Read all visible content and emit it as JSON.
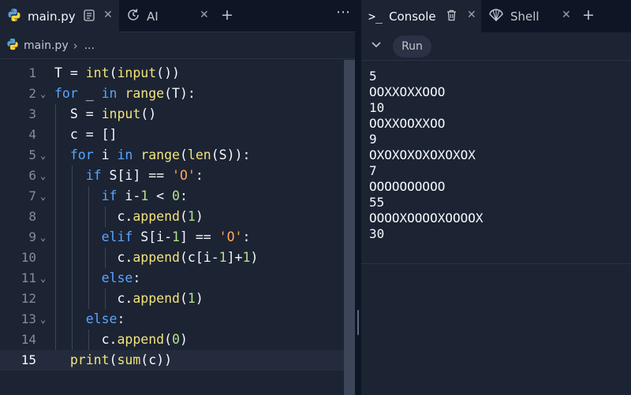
{
  "editor_tabs": [
    {
      "label": "main.py",
      "icon": "python-icon",
      "active": true
    },
    {
      "label": "AI",
      "icon": "ai-history-icon",
      "active": false
    }
  ],
  "breadcrumb": {
    "file": "main.py",
    "separator": "›",
    "more": "..."
  },
  "editor": {
    "current_line": 15,
    "lines": [
      {
        "num": "1"
      },
      {
        "num": "2"
      },
      {
        "num": "3"
      },
      {
        "num": "4"
      },
      {
        "num": "5"
      },
      {
        "num": "6"
      },
      {
        "num": "7"
      },
      {
        "num": "8"
      },
      {
        "num": "9"
      },
      {
        "num": "10"
      },
      {
        "num": "11"
      },
      {
        "num": "12"
      },
      {
        "num": "13"
      },
      {
        "num": "14"
      },
      {
        "num": "15"
      }
    ],
    "code": [
      "T = int(input())",
      "for _ in range(T):",
      "S = input()",
      "c = []",
      "for i in range(len(S)):",
      "if S[i] == 'O':",
      "if i-1 < 0:",
      "c.append(1)",
      "elif S[i-1] == 'O':",
      "c.append(c[i-1]+1)",
      "else:",
      "c.append(1)",
      "else:",
      "c.append(0)",
      "print(sum(c))"
    ]
  },
  "console_tabs": [
    {
      "label": "Console",
      "icon": "terminal-icon",
      "active": true
    },
    {
      "label": "Shell",
      "icon": "shell-icon",
      "active": false
    }
  ],
  "console": {
    "run_label": "Run",
    "output": [
      "5",
      "OOXXOXXOOO",
      "10",
      "OOXXOOXXOO",
      "9",
      "OXOXOXOXOXOXOX",
      "7",
      "OOOOOOOOOO",
      "55",
      "OOOOXOOOOXOOOOX",
      "30"
    ]
  },
  "colors": {
    "background": "#1c2333",
    "tabbar": "#0e1525",
    "keyword": "#59a6ff",
    "function": "#f2e37a",
    "string": "#ffa657",
    "number": "#b3e08a"
  }
}
